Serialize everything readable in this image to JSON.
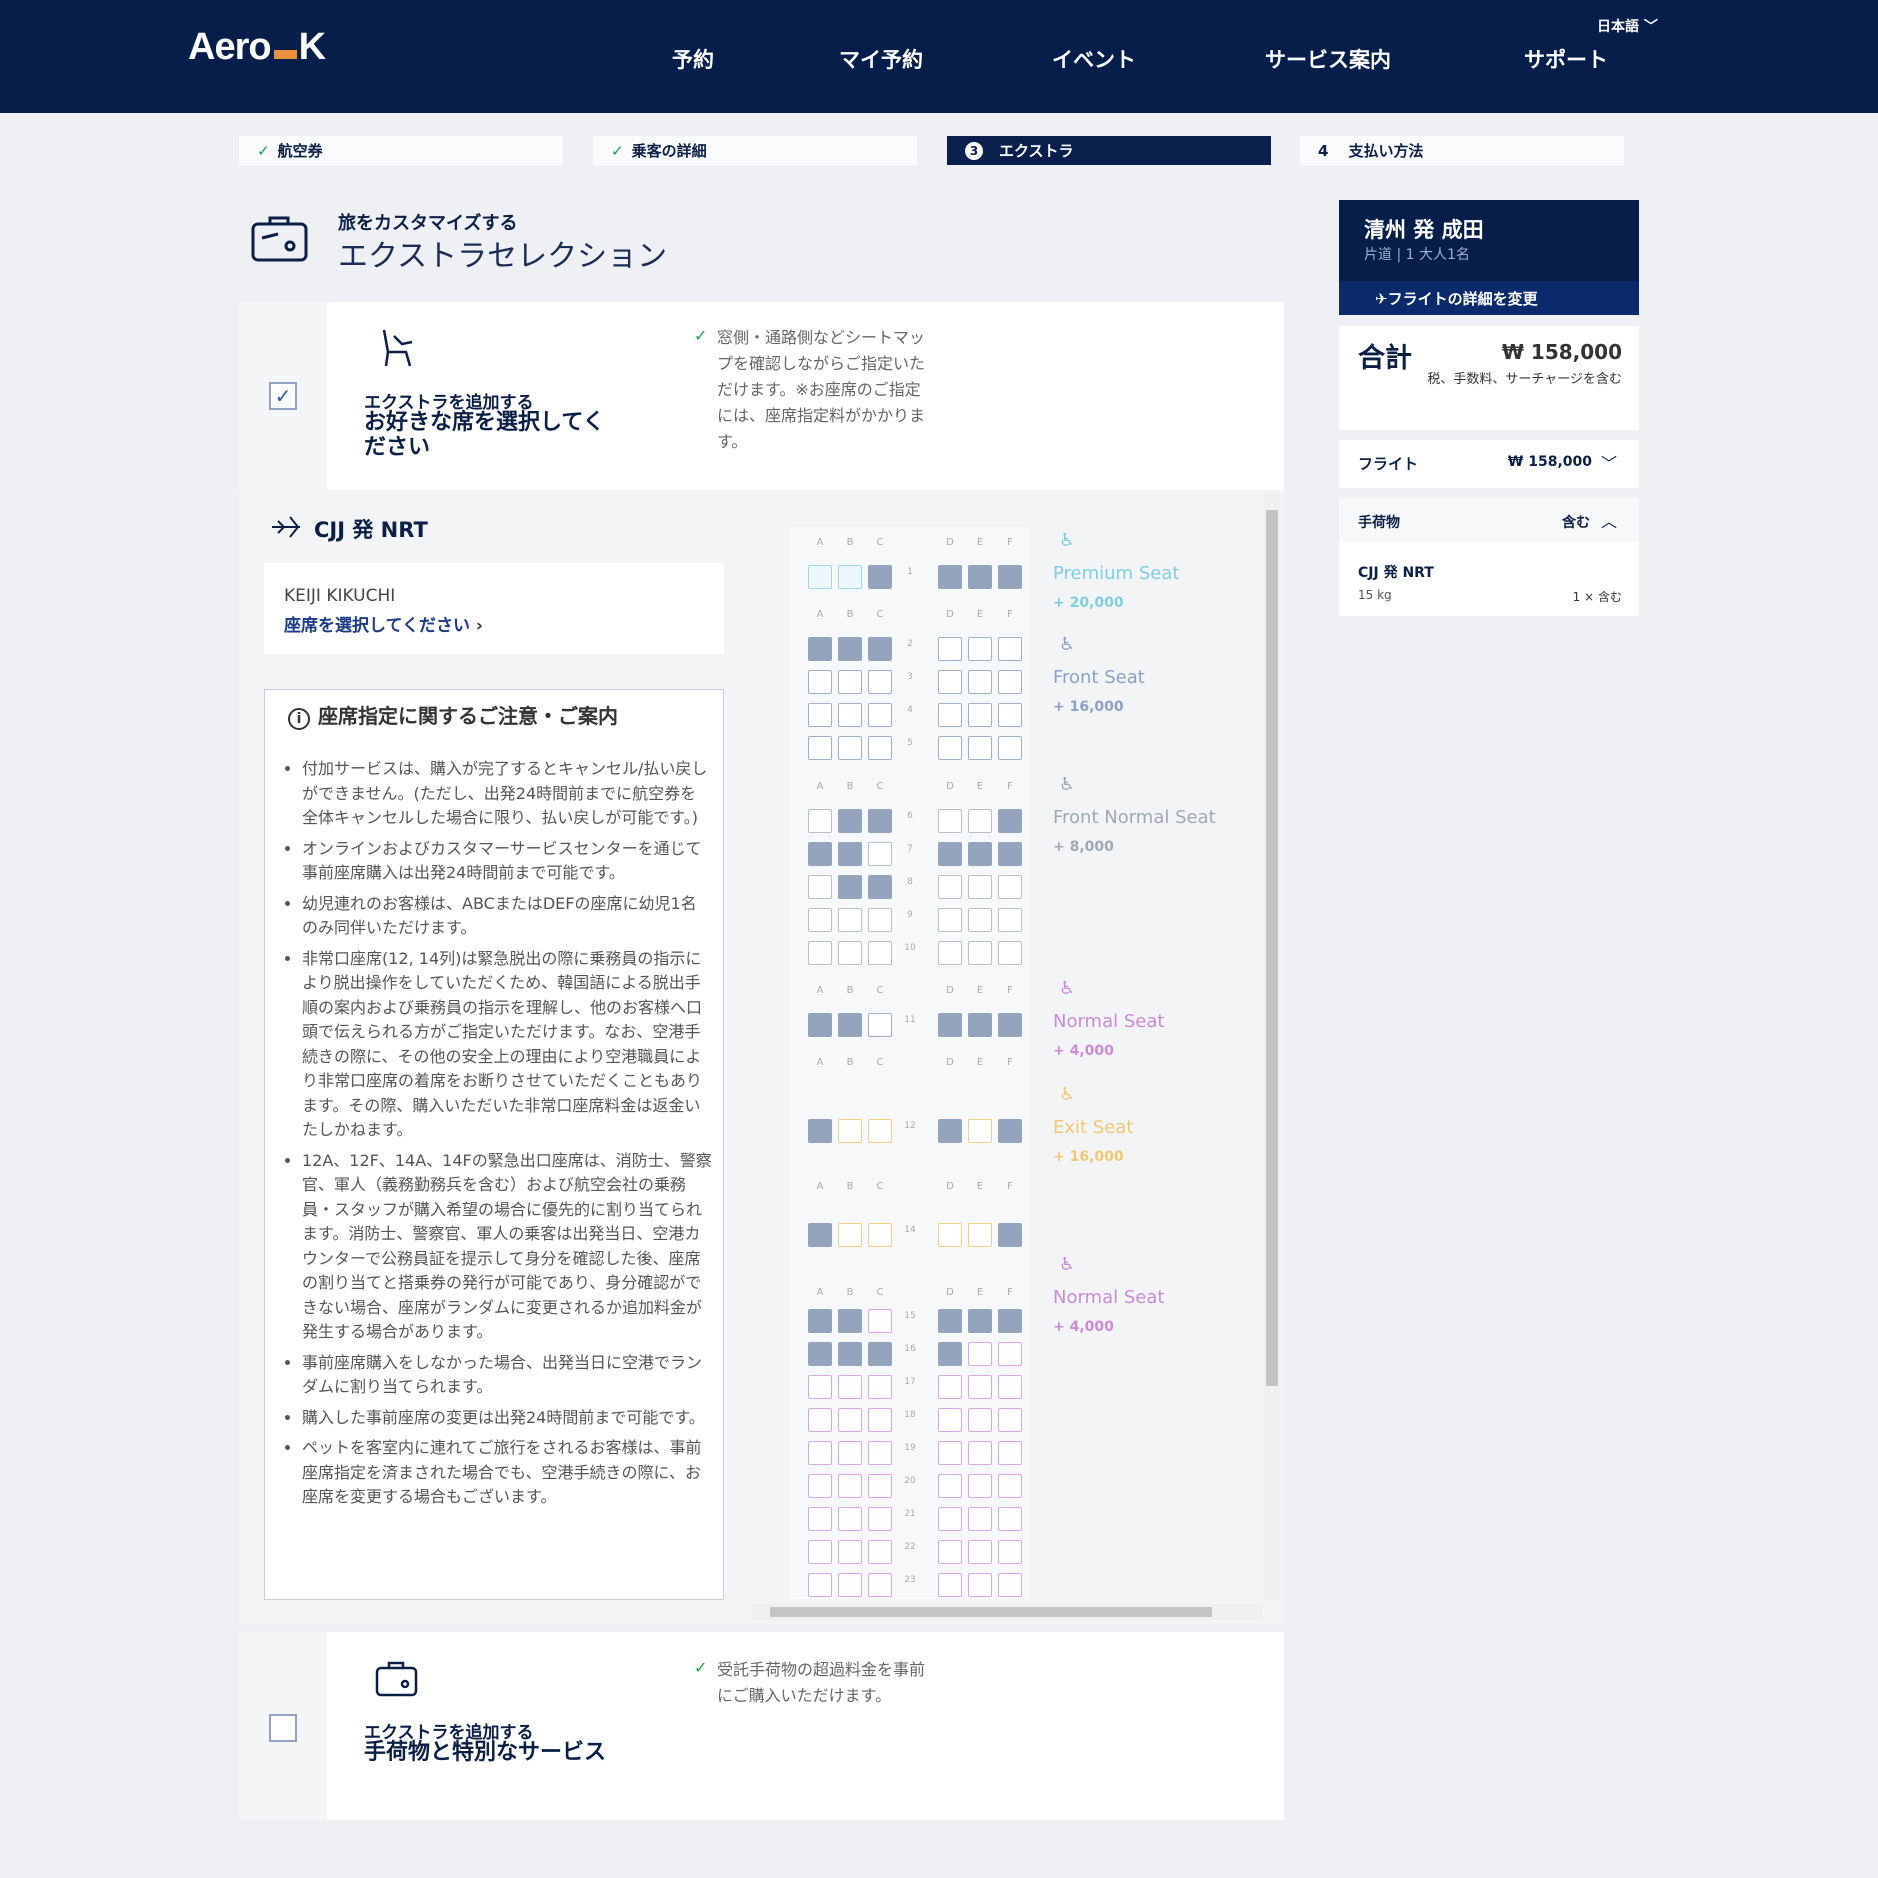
{
  "header": {
    "logo_left": "Aero",
    "logo_right": "K",
    "nav": [
      "予約",
      "マイ予約",
      "イベント",
      "サービス案内",
      "サポート"
    ],
    "lang": "日本語"
  },
  "steps": [
    {
      "label": "航空券",
      "done": true
    },
    {
      "label": "乗客の詳細",
      "done": true
    },
    {
      "num": "3",
      "label": "エクストラ",
      "active": true
    },
    {
      "num": "4",
      "label": "支払い方法"
    }
  ],
  "page": {
    "subtitle": "旅をカスタマイズする",
    "title": "エクストラセレクション"
  },
  "seat_extra": {
    "add_label": "エクストラを追加する",
    "title": "お好きな席を選択してください",
    "hint": "窓側・通路側などシートマップを確認しながらご指定いただけます。※お座席のご指定には、座席指定料がかかります。"
  },
  "flight": {
    "route": "CJJ 発 NRT",
    "passenger": "KEIJI KIKUCHI",
    "select_seat": "座席を選択してください"
  },
  "notice": {
    "title": "座席指定に関するご注意・ご案内",
    "items": [
      "付加サービスは、購入が完了するとキャンセル/払い戻しができません。(ただし、出発24時間前までに航空券を全体キャンセルした場合に限り、払い戻しが可能です。)",
      "オンラインおよびカスタマーサービスセンターを通じて事前座席購入は出発24時間前まで可能です。",
      "幼児連れのお客様は、ABCまたはDEFの座席に幼児1名のみ同伴いただけます。",
      "非常口座席(12, 14列)は緊急脱出の際に乗務員の指示により脱出操作をしていただくため、韓国語による脱出手順の案内および乗務員の指示を理解し、他のお客様へ口頭で伝えられる方がご指定いただけます。なお、空港手続きの際に、その他の安全上の理由により空港職員により非常口座席の着席をお断りさせていただくこともあります。その際、購入いただいた非常口座席料金は返金いたしかねます。",
      "12A、12F、14A、14Fの緊急出口座席は、消防士、警察官、軍人（義務勤務兵を含む）および航空会社の乗務員・スタッフが購入希望の場合に優先的に割り当てられます。消防士、警察官、軍人の乗客は出発当日、空港カウンターで公務員証を提示して身分を確認した後、座席の割り当てと搭乗券の発行が可能であり、身分確認ができない場合、座席がランダムに変更されるか追加料金が発生する場合があります。",
      "事前座席購入をしなかった場合、出発当日に空港でランダムに割り当てられます。",
      "購入した事前座席の変更は出発24時間前まで可能です。",
      "ペットを客室内に連れてご旅行をされるお客様は、事前座席指定を済まされた場合でも、空港手続きの際に、お座席を変更する場合もございます。"
    ]
  },
  "seat_cols": [
    "A",
    "B",
    "C",
    "D",
    "E",
    "F"
  ],
  "legend": [
    {
      "name": "Premium Seat",
      "price": "+ 20,000",
      "color": "#7fcde0"
    },
    {
      "name": "Front Seat",
      "price": "+ 16,000",
      "color": "#8aa0c4"
    },
    {
      "name": "Front Normal Seat",
      "price": "+ 8,000",
      "color": "#a0a8b4"
    },
    {
      "name": "Normal Seat",
      "price": "+ 4,000",
      "color": "#c98ad6"
    },
    {
      "name": "Exit Seat",
      "price": "+ 16,000",
      "color": "#f0c870"
    },
    {
      "name": "Normal Seat",
      "price": "+ 4,000",
      "color": "#c98ad6"
    }
  ],
  "baggage_extra": {
    "add_label": "エクストラを追加する",
    "title": "手荷物と特別なサービス",
    "hint": "受託手荷物の超過料金を事前にご購入いただけます。"
  },
  "summary": {
    "route": "清州 発 成田",
    "sub": "片道 | 1 大人1名",
    "change": "✈フライトの詳細を変更",
    "total_label": "合計",
    "total": "₩ 158,000",
    "total_note": "税、手数料、サーチャージを含む",
    "flight_label": "フライト",
    "flight_price": "₩ 158,000",
    "bag_label": "手荷物",
    "bag_status": "含む",
    "bag_route": "CJJ 発 NRT",
    "bag_weight": "15 kg",
    "bag_qty": "1 × 含む"
  }
}
